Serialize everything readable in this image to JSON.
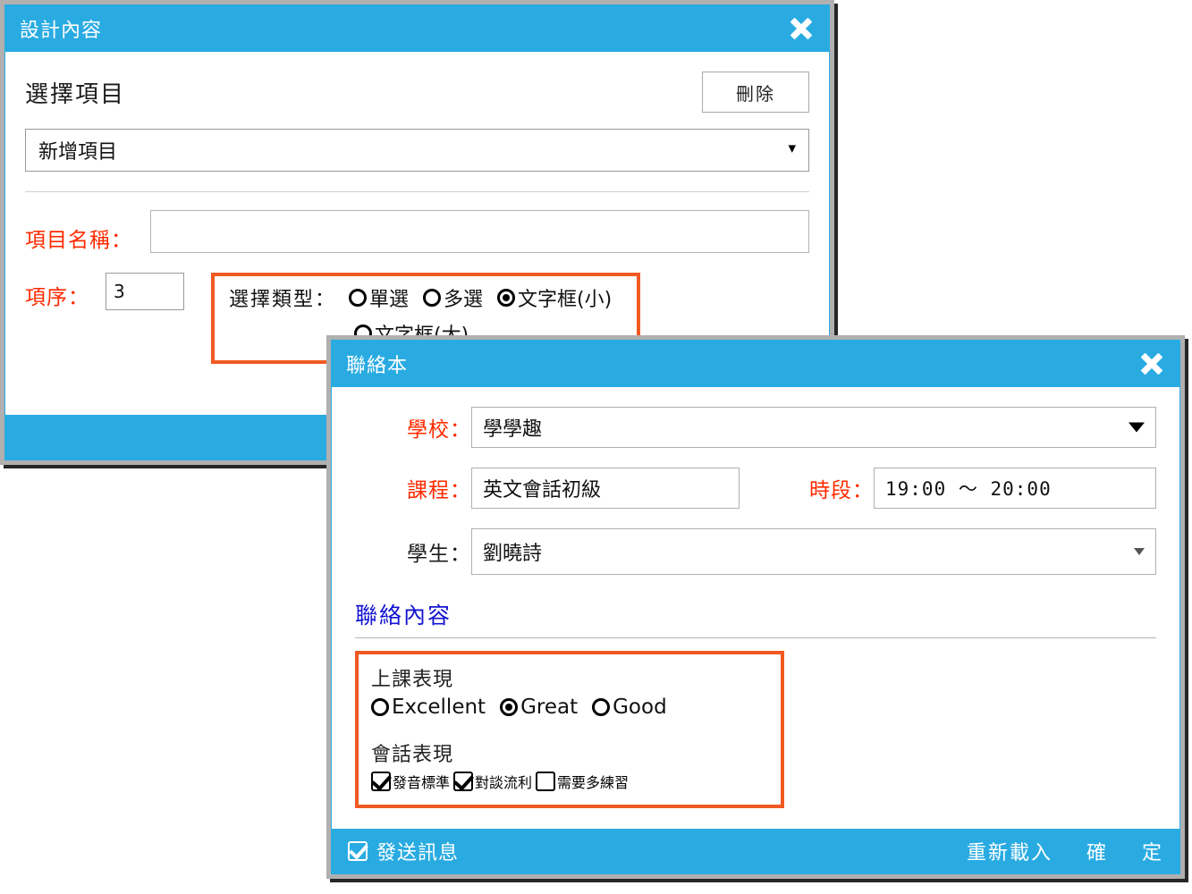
{
  "design_dialog": {
    "title": "設計內容",
    "close_icon": "close-x-icon",
    "section_title": "選擇項目",
    "delete_label": "刪除",
    "item_select_value": "新增項目",
    "chevron_icon": "chevron-down-icon",
    "name_label": "項目名稱：",
    "name_value": "",
    "order_label": "項序：",
    "order_value": "3",
    "type_label": "選擇類型：",
    "type_options": [
      {
        "label": "單選",
        "selected": false
      },
      {
        "label": "多選",
        "selected": false
      },
      {
        "label": "文字框(小)",
        "selected": true
      },
      {
        "label": "文字框(大)",
        "selected": false
      }
    ]
  },
  "contact_dialog": {
    "title": "聯絡本",
    "close_icon": "close-x-icon",
    "school_label": "學校：",
    "school_value": "學學趣",
    "course_label": "課程：",
    "course_value": "英文會話初級",
    "time_label": "時段：",
    "time_value": "19:00 ～ 20:00",
    "student_label": "學生：",
    "student_value": "劉曉詩",
    "content_heading": "聯絡內容",
    "class_perf_title": "上課表現",
    "class_perf_options": [
      {
        "label": "Excellent",
        "selected": false
      },
      {
        "label": "Great",
        "selected": true
      },
      {
        "label": "Good",
        "selected": false
      }
    ],
    "conv_perf_title": "會話表現",
    "conv_perf_options": [
      {
        "label": "發音標準",
        "checked": true
      },
      {
        "label": "對談流利",
        "checked": true
      },
      {
        "label": "需要多練習",
        "checked": false
      }
    ],
    "footer": {
      "send_msg_label": "發送訊息",
      "send_msg_checked": true,
      "reload_label": "重新載入",
      "confirm_label": "確",
      "ok_label": "定"
    }
  },
  "theme": {
    "header_blue": "#29abe2",
    "accent_orange": "#f15a22",
    "label_red": "#ff2a00",
    "heading_blue": "#1414d2",
    "frame_gray": "#b0b0b0"
  }
}
